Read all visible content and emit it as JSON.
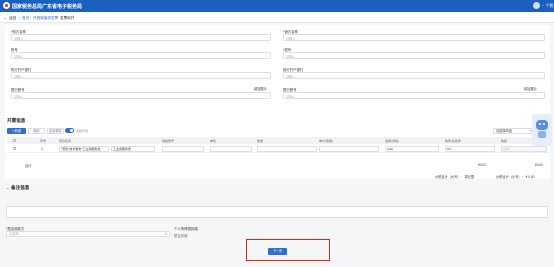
{
  "header": {
    "app_title": "国家税务总局广东省电子税务局",
    "user_name": "~ 个税"
  },
  "breadcrumb": {
    "back_label": "返回",
    "items": [
      "首页",
      "开具增值税发票",
      "发票填开"
    ]
  },
  "seller_buyer": {
    "fields": [
      {
        "label": "*购方名称",
        "placeholder": "请输入"
      },
      {
        "label": "*销方名称",
        "placeholder": "请输入"
      },
      {
        "label": "税号",
        "placeholder": "请输入"
      },
      {
        "label": "*税号",
        "placeholder": "请输入"
      },
      {
        "label": "购方开户银行",
        "placeholder": "请输入"
      },
      {
        "label": "销方开户银行",
        "placeholder": "请输入"
      },
      {
        "label": "银行账号",
        "placeholder": "请输入",
        "extra": "增加展示"
      },
      {
        "label": "银行账号",
        "placeholder": "请输入",
        "extra": "增加展示"
      }
    ]
  },
  "invoice_info": {
    "title": "开票信息",
    "buttons": [
      "+ 新增",
      "删除",
      "批量删除"
    ],
    "toggle_label": "含税开票",
    "right_select": "请选择商品",
    "columns": [
      "序号",
      "项目名称",
      "规格型号",
      "单位",
      "数量",
      "单价(含税)",
      "金额(含税)",
      "税率/征收率",
      "税额"
    ],
    "rows": [
      {
        "index": "1",
        "item_name": "*劳务*技术服务*工业用服务费",
        "spec": "工业用服务费",
        "unit": "",
        "qty": "",
        "price": "",
        "amount": "0.00",
        "rate": "6%",
        "tax": "0.00"
      }
    ],
    "total_label": "合计",
    "total_amount": "¥0.00",
    "total_tax": "¥0.00",
    "summary_left": "价税合计（大写）：  零元整",
    "summary_right": "价税合计（小写）：  ¥ 0.00"
  },
  "remarks": {
    "title": "备注信息"
  },
  "footer_fields": [
    {
      "label": "*是否收款方",
      "value": "请选择"
    },
    {
      "label": "个人所得税扣缴",
      "value": "是否扣缴"
    }
  ],
  "actions": {
    "next_label": "下一步"
  }
}
